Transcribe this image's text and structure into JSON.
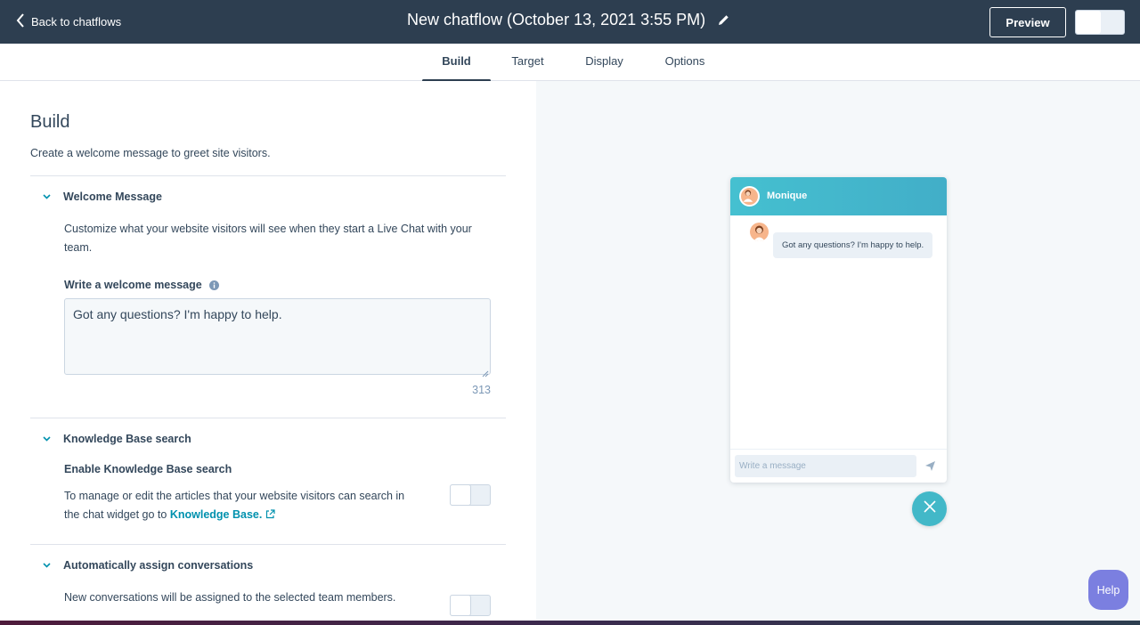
{
  "topbar": {
    "back_label": "Back to chatflows",
    "title": "New chatflow (October 13, 2021 3:55 PM)",
    "preview_label": "Preview"
  },
  "tabs": [
    {
      "label": "Build",
      "active": true
    },
    {
      "label": "Target",
      "active": false
    },
    {
      "label": "Display",
      "active": false
    },
    {
      "label": "Options",
      "active": false
    }
  ],
  "build": {
    "heading": "Build",
    "subheading": "Create a welcome message to greet site visitors.",
    "welcome": {
      "title": "Welcome Message",
      "description_line1": "Customize what your website visitors will see when they start a Live Chat with your",
      "description_line2": "team.",
      "field_label": "Write a welcome message",
      "field_value": "Got any questions? I'm happy to help.",
      "char_count": "313"
    },
    "kb": {
      "title": "Knowledge Base search",
      "label": "Enable Knowledge Base search",
      "text_line1": "To manage or edit the articles that your website visitors can search in",
      "text_line2_prefix": "the chat widget go to ",
      "link": "Knowledge Base.",
      "enabled": false
    },
    "assign": {
      "title": "Automatically assign conversations",
      "text": "New conversations will be assigned to the selected team members.",
      "enabled": false
    }
  },
  "preview": {
    "agent_name": "Monique",
    "message": "Got any questions? I'm happy to help.",
    "input_placeholder": "Write a message"
  },
  "help_label": "Help",
  "colors": {
    "topbar": "#2d3e50",
    "accent": "#42b8c8",
    "link": "#0091ae",
    "help": "#7b7fe0"
  }
}
